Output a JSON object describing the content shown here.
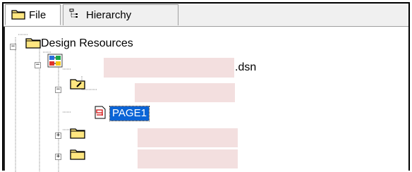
{
  "tabs": [
    {
      "label": "File",
      "icon": "folder-icon"
    },
    {
      "label": "Hierarchy",
      "icon": "hierarchy-icon"
    }
  ],
  "tree": {
    "root": {
      "label": "Design Resources"
    },
    "design": {
      "suffix": ".dsn"
    },
    "page": {
      "label": "PAGE1"
    }
  },
  "colors": {
    "folder_yellow": "#ffe680",
    "selection": "#0a64d6",
    "redaction": "#f3dfdf"
  }
}
